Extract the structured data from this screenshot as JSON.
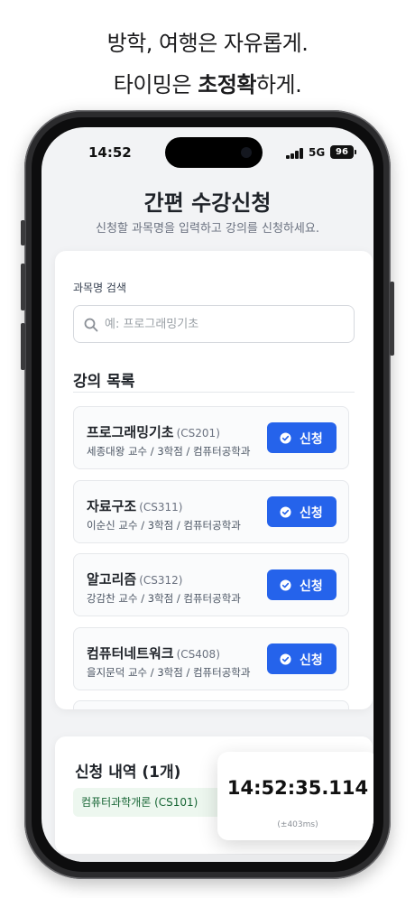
{
  "promo": {
    "line1": "방학, 여행은 자유롭게.",
    "line2_prefix": "타이밍은 ",
    "line2_bold": "초정확",
    "line2_suffix": "하게."
  },
  "status_bar": {
    "time": "14:52",
    "network": "5G",
    "battery": "96"
  },
  "header": {
    "title": "간편 수강신청",
    "subtitle": "신청할 과목명을 입력하고 강의를 신청하세요."
  },
  "search": {
    "label": "과목명 검색",
    "placeholder": "예: 프로그래밍기초",
    "value": ""
  },
  "course_list": {
    "title": "강의 목록",
    "courses": [
      {
        "name": "프로그래밍기초",
        "code": "(CS201)",
        "meta": "세종대왕 교수 / 3학점 / 컴퓨터공학과",
        "button": "신청"
      },
      {
        "name": "자료구조",
        "code": "(CS311)",
        "meta": "이순신 교수 / 3학점 / 컴퓨터공학과",
        "button": "신청"
      },
      {
        "name": "알고리즘",
        "code": "(CS312)",
        "meta": "강감찬 교수 / 3학점 / 컴퓨터공학과",
        "button": "신청"
      },
      {
        "name": "컴퓨터네트워크",
        "code": "(CS408)",
        "meta": "을지문덕 교수 / 3학점 / 컴퓨터공학과",
        "button": "신청"
      }
    ]
  },
  "history": {
    "title": "신청 내역 (1개)",
    "items": [
      "컴퓨터과학개론 (CS101)"
    ]
  },
  "timer": {
    "clock": "14:52:35.114",
    "offset": "(±403ms)"
  },
  "colors": {
    "primary": "#2563eb",
    "success_bg": "#edf7ef",
    "success_text": "#166534"
  }
}
